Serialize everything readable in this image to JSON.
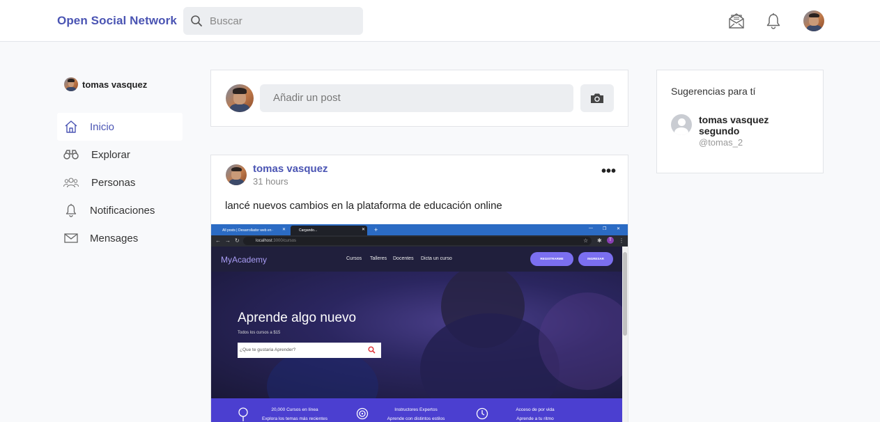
{
  "header": {
    "brand": "Open Social Network",
    "search_placeholder": "Buscar"
  },
  "sidebar": {
    "user_name": "tomas vasquez",
    "items": [
      {
        "label": "Inicio",
        "icon": "home-icon",
        "active": true
      },
      {
        "label": "Explorar",
        "icon": "binoculars-icon",
        "active": false
      },
      {
        "label": "Personas",
        "icon": "people-icon",
        "active": false
      },
      {
        "label": "Notificaciones",
        "icon": "bell-icon",
        "active": false
      },
      {
        "label": "Mensages",
        "icon": "envelope-icon",
        "active": false
      }
    ]
  },
  "composer": {
    "placeholder": "Añadir un post"
  },
  "post": {
    "author": "tomas vasquez",
    "time": "31 hours",
    "text": "lancé nuevos cambios en la plataforma de educación online",
    "attachment": {
      "tabs": [
        "All posts | Desarrollador web en ·",
        "Cargando..."
      ],
      "url_host": "localhost",
      "url_path": ":3000/cursos",
      "site_logo": "MyAcademy",
      "site_links": [
        "Cursos",
        "Talleres",
        "Docentes",
        "Dicta un curso"
      ],
      "btn_register": "REGISTRARME",
      "btn_login": "INGRESAR",
      "hero_title": "Aprende algo nuevo",
      "hero_subtitle": "Todos los cursos a $15",
      "hero_search_placeholder": "¿Que te gustaria Aprender?",
      "features": [
        {
          "line1": "20,000 Cursos en línea",
          "line2": "Explora los temas más recientes"
        },
        {
          "line1": "Instructores Expertos",
          "line2": "Aprende con distintos estilos"
        },
        {
          "line1": "Acceso de por vida",
          "line2": "Aprende a tu ritmo"
        }
      ]
    }
  },
  "suggestions": {
    "title": "Sugerencias para tí",
    "items": [
      {
        "name": "tomas vasquez segundo",
        "handle": "@tomas_2"
      }
    ]
  },
  "colors": {
    "accent": "#4a54b3",
    "page_bg": "#f8f9fb",
    "input_bg": "#eceef1"
  }
}
